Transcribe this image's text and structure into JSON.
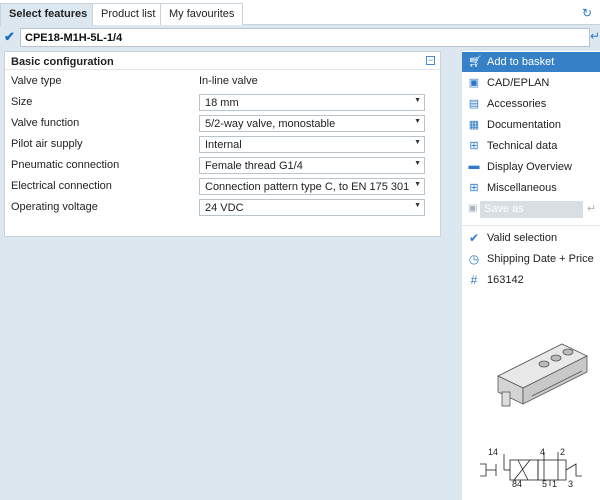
{
  "tabs": [
    {
      "label": "Select features",
      "active": true
    },
    {
      "label": "Product list",
      "active": false
    },
    {
      "label": "My favourites",
      "active": false
    }
  ],
  "product_code": "CPE18-M1H-5L-1/4",
  "panel": {
    "title": "Basic configuration",
    "rows": [
      {
        "label": "Valve type",
        "value": "In-line valve",
        "dropdown": false
      },
      {
        "label": "Size",
        "value": "18 mm",
        "dropdown": true
      },
      {
        "label": "Valve function",
        "value": "5/2-way valve, monostable",
        "dropdown": true
      },
      {
        "label": "Pilot air supply",
        "value": "Internal",
        "dropdown": true
      },
      {
        "label": "Pneumatic connection",
        "value": "Female thread G1/4",
        "dropdown": true
      },
      {
        "label": "Electrical connection",
        "value": "Connection pattern type C, to EN 175 301",
        "dropdown": true
      },
      {
        "label": "Operating voltage",
        "value": "24 VDC",
        "dropdown": true
      }
    ]
  },
  "sidebar": {
    "menu": [
      {
        "label": "Add to basket",
        "icon": "basket-icon",
        "active": true
      },
      {
        "label": "CAD/EPLAN",
        "icon": "cad-icon",
        "active": false
      },
      {
        "label": "Accessories",
        "icon": "accessories-icon",
        "active": false
      },
      {
        "label": "Documentation",
        "icon": "pdf-icon",
        "active": false
      },
      {
        "label": "Technical data",
        "icon": "table-icon",
        "active": false
      },
      {
        "label": "Display Overview",
        "icon": "display-icon",
        "active": false
      },
      {
        "label": "Miscellaneous",
        "icon": "plus-box-icon",
        "active": false
      }
    ],
    "save_as": "Save as",
    "status": [
      {
        "label": "Valid selection",
        "icon": "checkmark-icon"
      },
      {
        "label": "Shipping Date + Price",
        "icon": "clock-icon"
      },
      {
        "label": "163142",
        "icon": "hash-icon"
      }
    ],
    "symbol_labels": {
      "pilot": "14",
      "port4": "4",
      "port2": "2",
      "port84": "84",
      "port5": "5",
      "port1": "1",
      "port3": "3"
    }
  },
  "colors": {
    "accent": "#3680c8",
    "icon_blue": "#2d79c7",
    "background": "#dde7f0"
  }
}
